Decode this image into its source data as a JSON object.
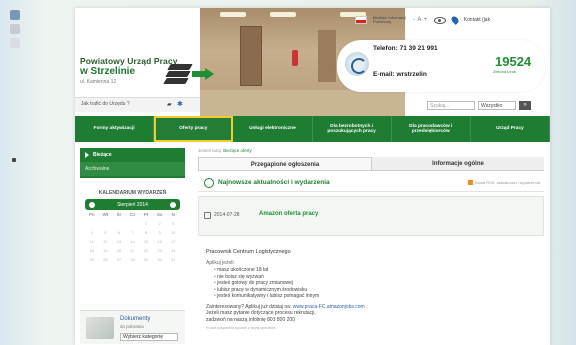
{
  "header": {
    "org_line1": "Powiatowy Urząd Pracy",
    "org_line2": "w Strzelinie",
    "address": "ul. Kamienna 12",
    "bip_label": "Biuletyn Informacji Publicznej",
    "font_size_label": "- A +",
    "contact_label": "Kontakt (jak",
    "phone": "Telefon: 71 39 21 991",
    "email": "E-mail: wrstrzelin",
    "hotline_number": "19524",
    "hotline_sub": "Zielona Linia",
    "quick_text": "Jak trafić do Urzędu ?",
    "search_placeholder": "Szukaj...",
    "search_scope": "Wszystko",
    "search_go": "»"
  },
  "nav": {
    "items": [
      "Formy aktywizacji",
      "Oferty pracy",
      "Usługi elektroniczne",
      "Dla bezrobotnych i poszukujących pracy",
      "Dla pracodawców i przedsiębiorców",
      "Urząd Pracy"
    ]
  },
  "sidebar": {
    "item_current": "Bieżące",
    "item_archive": "Archiwalne",
    "calendar_title": "KALENDARIUM WYDARZEŃ",
    "calendar_month": "Sierpień 2014",
    "weekdays": [
      "Pn",
      "Wt",
      "Śr",
      "Cz",
      "Pt",
      "So",
      "N"
    ],
    "days": [
      "",
      "",
      "",
      "",
      "1",
      "2",
      "3",
      "4",
      "5",
      "6",
      "7",
      "8",
      "9",
      "10",
      "11",
      "12",
      "13",
      "14",
      "15",
      "16",
      "17",
      "18",
      "19",
      "20",
      "21",
      "22",
      "23",
      "24",
      "25",
      "26",
      "27",
      "28",
      "29",
      "30",
      "31"
    ],
    "docs_title": "Dokumenty",
    "docs_sub": "do pobrania",
    "docs_select": "Wybierz kategorię"
  },
  "main": {
    "breadcrumb_prefix": "Jesteś tutaj:",
    "breadcrumb_current": "Bieżące oferty",
    "tab_news": "Przegapione ogłoszenia",
    "tab_info": "Informacje ogólne",
    "news_title": "Najnowsze aktualności i wydarzenia",
    "rss_label": "Kanał RSS: aktualności i wydarzenia",
    "offer_date": "2014-07-28",
    "offer_title": "Amazon oferta pracy",
    "job_name": "Pracownik Centrum Logistycznego",
    "job_label": "Aplikuj jeżeli:",
    "job_points": [
      "masz ukończone 18 lat",
      "nie boisz się wyzwań",
      "jesteś gotowy do pracy zmianowej",
      "lubisz pracę w dynamicznym środowisku",
      "jesteś komunikatywny i lubisz pomagać innym"
    ],
    "contact_line1": "Zainteresowany? Aplikuj już dzisiaj na:",
    "contact_link": "www.praca-FC.amazonjobs.com",
    "contact_line2": "Jeżeli masz pytanie dotyczące procesu rekrutacji,",
    "contact_line3": "zadzwoń na naszą infolinię 801 800 200",
    "small_print": "*Koszt połączenia zgodnie z taryfą operatora"
  },
  "colors": {
    "brand_green": "#1e7d32",
    "accent_yellow": "#f1cd2c",
    "link_blue": "#2a62b0"
  }
}
